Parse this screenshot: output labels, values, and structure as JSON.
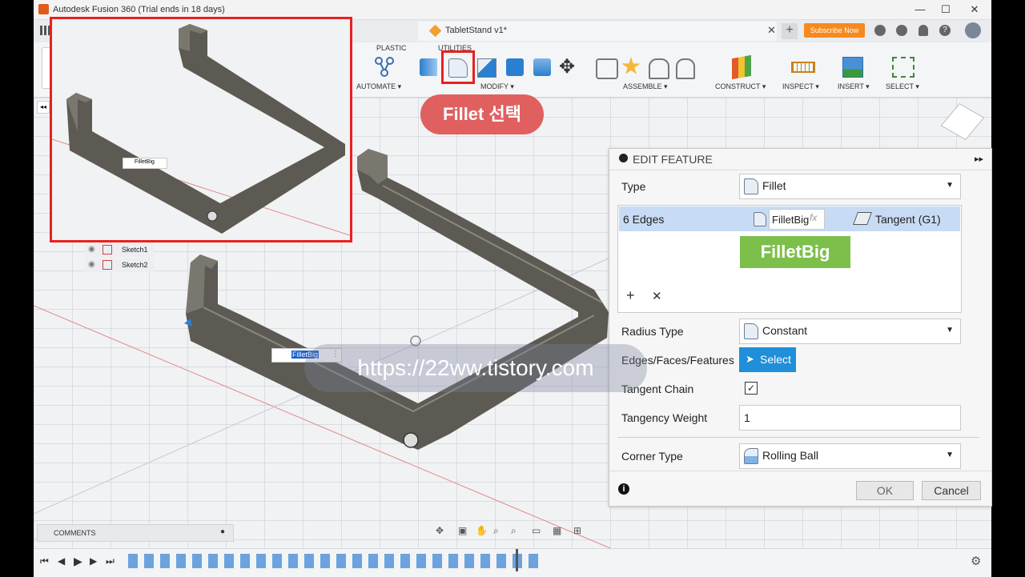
{
  "window": {
    "title": "Autodesk Fusion 360 (Trial ends in 18 days)",
    "document_tab": "TabletStand v1*",
    "subscribe": "Subscribe Now"
  },
  "toolbar": {
    "tab_plastic": "PLASTIC",
    "tab_utilities": "UTILITIES",
    "groups": {
      "automate": "AUTOMATE ▾",
      "modify": "MODIFY ▾",
      "assemble": "ASSEMBLE ▾",
      "construct": "CONSTRUCT ▾",
      "inspect": "INSPECT ▾",
      "insert": "INSERT ▾",
      "select": "SELECT ▾"
    }
  },
  "annotation": {
    "callout": "Fillet 선택",
    "watermark": "https://22ww.tistory.com"
  },
  "browser": {
    "items": [
      "Sketch1",
      "Sketch2"
    ],
    "comments": "COMMENTS"
  },
  "viewport": {
    "edit_chip": "FilletBig",
    "inset_chip": "FilletBig"
  },
  "panel": {
    "header": "EDIT FEATURE",
    "type_label": "Type",
    "type_value": "Fillet",
    "edges_label": "6 Edges",
    "edges_name": "FilletBig",
    "edges_fx": "fx",
    "edges_continuity": "Tangent (G1)",
    "green_label": "FilletBig",
    "radius_type_label": "Radius Type",
    "radius_type_value": "Constant",
    "edges_faces_label": "Edges/Faces/Features",
    "select_button": "Select",
    "tangent_chain_label": "Tangent Chain",
    "tangent_chain_checked": true,
    "tangency_weight_label": "Tangency Weight",
    "tangency_weight_value": "1",
    "corner_type_label": "Corner Type",
    "corner_type_value": "Rolling Ball",
    "ok": "OK",
    "cancel": "Cancel"
  },
  "colors": {
    "highlight_red": "#e8211f",
    "callout_bg": "#e06060",
    "select_blue": "#1e8fd8",
    "green_badge": "#7cbf4a",
    "row_selected": "#c7dcf4",
    "subscribe_orange": "#f58a1f",
    "model_body": "#5c5a52"
  }
}
